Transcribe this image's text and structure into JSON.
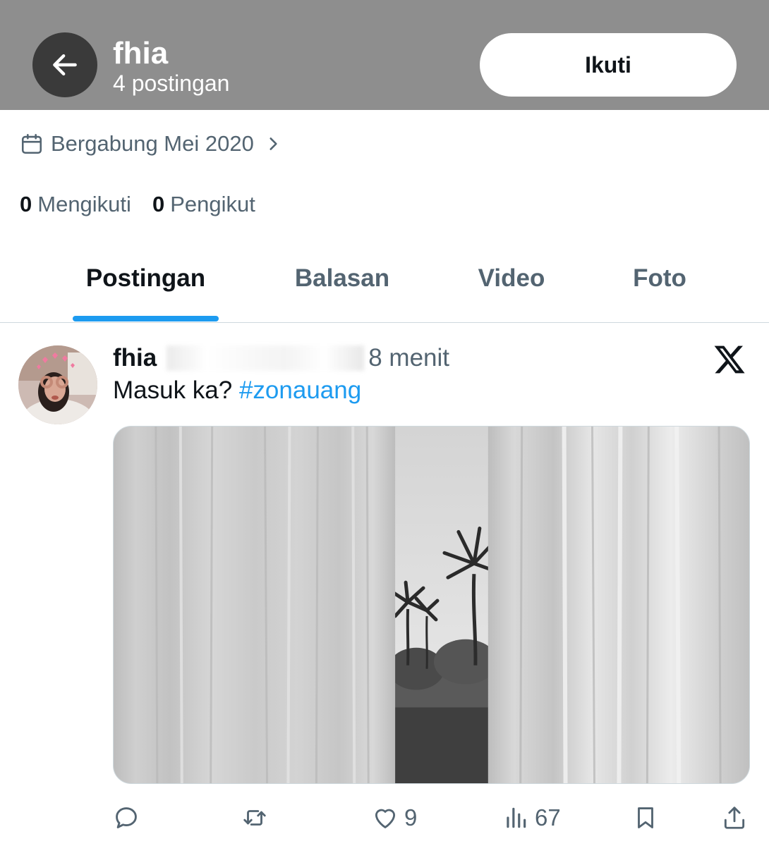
{
  "header": {
    "name": "fhia",
    "post_count": "4 postingan",
    "follow_label": "Ikuti",
    "back_icon": "arrow-left-icon"
  },
  "profile": {
    "joined": "Bergabung Mei 2020",
    "following_count": "0",
    "following_label": "Mengikuti",
    "followers_count": "0",
    "followers_label": "Pengikut"
  },
  "tabs": [
    {
      "label": "Postingan",
      "active": true
    },
    {
      "label": "Balasan",
      "active": false
    },
    {
      "label": "Video",
      "active": false
    },
    {
      "label": "Foto",
      "active": false
    }
  ],
  "post": {
    "author": "fhia",
    "time": "8 menit",
    "text": "Masuk ka? ",
    "hashtag": "#zonauang",
    "actions": {
      "reply_count": "",
      "repost_count": "",
      "like_count": "9",
      "views_count": "67"
    }
  },
  "colors": {
    "header_bg": "#8e8e8e",
    "accent": "#1d9bf0",
    "secondary_text": "#536471",
    "primary_text": "#0f1419"
  }
}
